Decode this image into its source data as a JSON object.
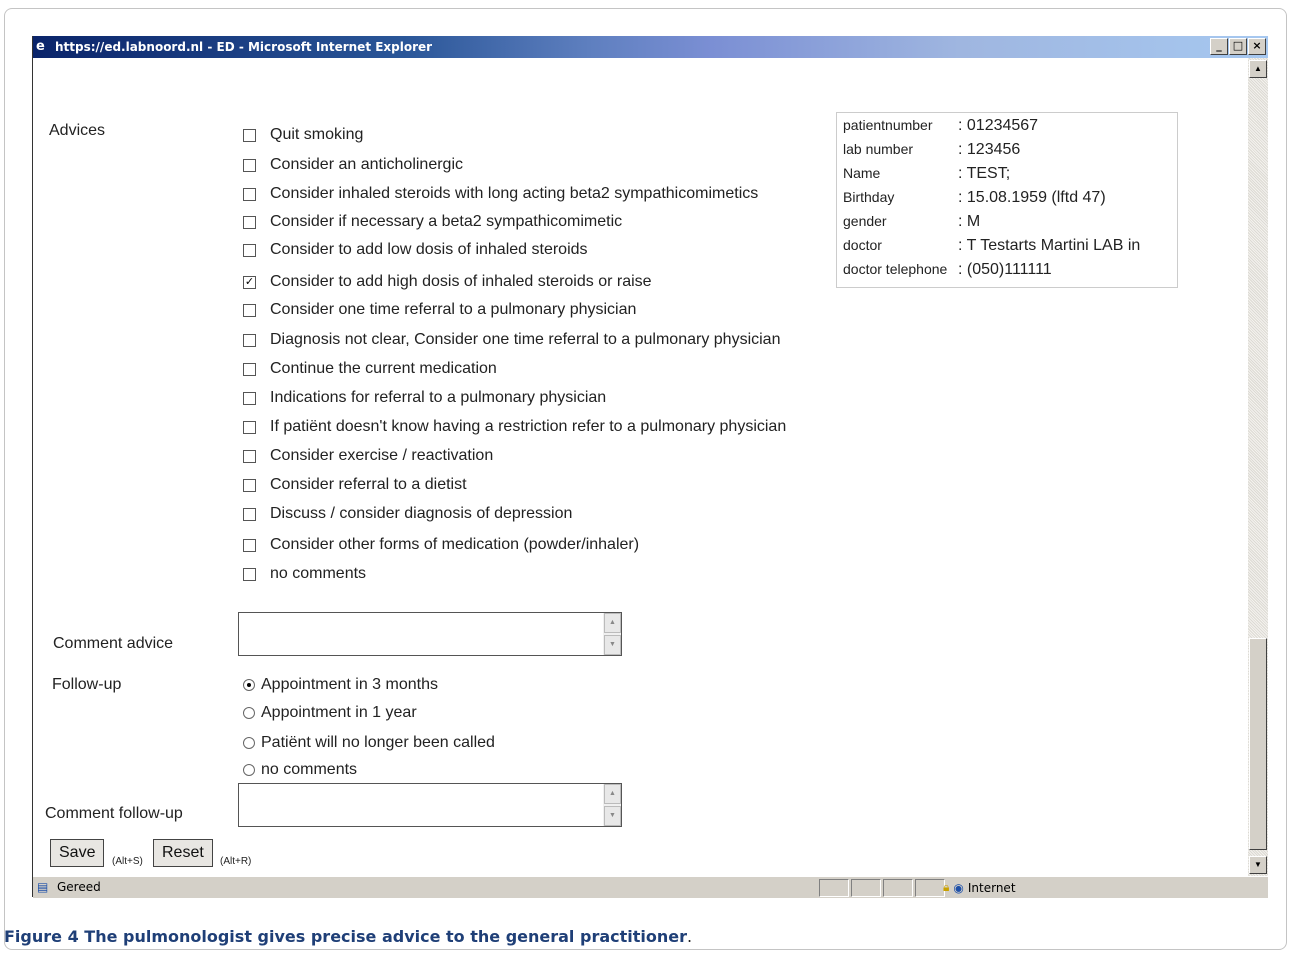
{
  "window": {
    "title": "https://ed.labnoord.nl - ED - Microsoft Internet Explorer",
    "minimize": "_",
    "maximize": "□",
    "close": "×"
  },
  "form": {
    "advices_label": "Advices",
    "advices": [
      {
        "label": "Quit smoking",
        "checked": false
      },
      {
        "label": "Consider an anticholinergic",
        "checked": false
      },
      {
        "label": "Consider inhaled steroids with long acting beta2 sympathicomimetics",
        "checked": false
      },
      {
        "label": "Consider  if necessary a beta2 sympathicomimetic",
        "checked": false
      },
      {
        "label": "Consider  to add low dosis of inhaled steroids",
        "checked": false
      },
      {
        "label": "Consider  to add  high  dosis of inhaled steroids  or raise",
        "checked": true
      },
      {
        "label": "Consider one time referral to a pulmonary physician",
        "checked": false
      },
      {
        "label": "Diagnosis not clear, Consider one time referral to a pulmonary physician",
        "checked": false
      },
      {
        "label": "Continue the current medication",
        "checked": false
      },
      {
        "label": "Indications for  referral  to  a  pulmonary physician",
        "checked": false
      },
      {
        "label": "If patiënt doesn't know having a restriction refer to a pulmonary physician",
        "checked": false
      },
      {
        "label": "Consider  exercise / reactivation",
        "checked": false
      },
      {
        "label": "Consider  referral to a  dietist",
        "checked": false
      },
      {
        "label": "Discuss / consider diagnosis of depression",
        "checked": false
      },
      {
        "label": "Consider other forms of medication (powder/inhaler)",
        "checked": false
      },
      {
        "label": "no comments",
        "checked": false
      }
    ],
    "comment_advice_label": "Comment advice",
    "comment_advice_value": "",
    "followup_label": "Follow-up",
    "followup_options": [
      {
        "label": "Appointment in 3 months",
        "selected": true
      },
      {
        "label": "Appointment in 1 year",
        "selected": false
      },
      {
        "label": "Patiënt will no longer been called",
        "selected": false
      },
      {
        "label": "no comments",
        "selected": false
      }
    ],
    "comment_followup_label": "Comment follow-up",
    "comment_followup_value": "",
    "save_label": "Save",
    "save_shortcut": "(Alt+S)",
    "reset_label": "Reset",
    "reset_shortcut": "(Alt+R)"
  },
  "patient": {
    "rows": [
      {
        "key": "patientnumber",
        "value": ": 01234567"
      },
      {
        "key": "lab number",
        "value": ": 123456"
      },
      {
        "key": "Name",
        "value": ": TEST;"
      },
      {
        "key": "Birthday",
        "value": ": 15.08.1959 (lftd 47)"
      },
      {
        "key": "gender",
        "value": ": M"
      },
      {
        "key": "doctor",
        "value": ": T Testarts Martini LAB in"
      },
      {
        "key": "doctor telephone",
        "value": ": (050)111111"
      }
    ]
  },
  "statusbar": {
    "text": "Gereed",
    "zone": "Internet",
    "icons": [
      "page-icon",
      "lock-icon",
      "globe-icon"
    ]
  },
  "caption": {
    "bold": "Figure 4 The pulmonologist gives precise advice to the general practitioner",
    "tail": "."
  }
}
